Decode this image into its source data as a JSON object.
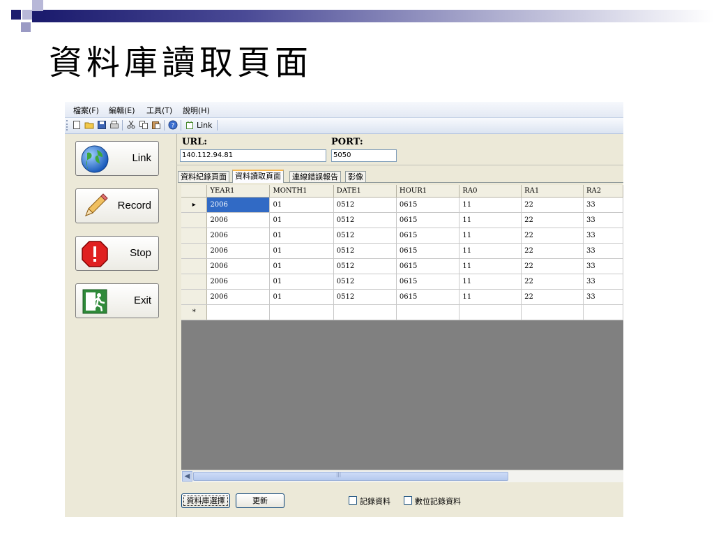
{
  "slide": {
    "title": "資料庫讀取頁面"
  },
  "menu": [
    "檔案(F)",
    "編輯(E)",
    "工具(T)",
    "說明(H)"
  ],
  "toolbar": {
    "link_label": "Link"
  },
  "side_buttons": {
    "link": "Link",
    "record": "Record",
    "stop": "Stop",
    "exit": "Exit"
  },
  "connection": {
    "url_label": "URL:",
    "url_value": "140.112.94.81",
    "port_label": "PORT:",
    "port_value": "5050"
  },
  "tabs": [
    "資料紀錄頁面",
    "資料讀取頁面",
    "連線錯誤報告",
    "影像"
  ],
  "active_tab": 1,
  "grid": {
    "columns": [
      "YEAR1",
      "MONTH1",
      "DATE1",
      "HOUR1",
      "RA0",
      "RA1",
      "RA2"
    ],
    "rows": [
      [
        "2006",
        "01",
        "0512",
        "0615",
        "11",
        "22",
        "33"
      ],
      [
        "2006",
        "01",
        "0512",
        "0615",
        "11",
        "22",
        "33"
      ],
      [
        "2006",
        "01",
        "0512",
        "0615",
        "11",
        "22",
        "33"
      ],
      [
        "2006",
        "01",
        "0512",
        "0615",
        "11",
        "22",
        "33"
      ],
      [
        "2006",
        "01",
        "0512",
        "0615",
        "11",
        "22",
        "33"
      ],
      [
        "2006",
        "01",
        "0512",
        "0615",
        "11",
        "22",
        "33"
      ],
      [
        "2006",
        "01",
        "0512",
        "0615",
        "11",
        "22",
        "33"
      ]
    ],
    "current_row_marker": "▸",
    "new_row_marker": "*"
  },
  "bottom": {
    "select_db_button": "資料庫選擇",
    "refresh_button": "更新",
    "checkbox_record": "記錄資料",
    "checkbox_digital_record": "數位記錄資料"
  },
  "colors": {
    "selection": "#316ac5",
    "grid_background": "#808080",
    "title_bar_dark": "#1c1c6e"
  }
}
